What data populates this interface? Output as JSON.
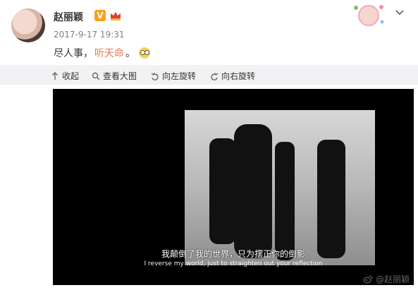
{
  "post": {
    "username": "赵丽颖",
    "verified_badge": "V",
    "timestamp": "2017-9-17 19:31",
    "text_prefix": "尽人事，",
    "text_highlight": "听天命",
    "text_suffix": "。"
  },
  "toolbar": {
    "collapse_label": "收起",
    "view_large_label": "查看大图",
    "rotate_left_label": "向左旋转",
    "rotate_right_label": "向右旋转"
  },
  "image": {
    "subtitle_cn": "我颠倒了我的世界，只为摆正你的倒影",
    "subtitle_en": "I reverse my world, just to straighten out your reflection",
    "watermark": "@赵丽颖"
  },
  "colors": {
    "link_red": "#eb7350",
    "toolbar_bg": "#f2f2f5",
    "text_main": "#333333",
    "time_gray": "#808080"
  },
  "icons": {
    "collapse": "arrow-up-icon",
    "view_large": "magnifier-icon",
    "rotate_left": "rotate-left-icon",
    "rotate_right": "rotate-right-icon",
    "menu": "chevron-down-icon"
  }
}
